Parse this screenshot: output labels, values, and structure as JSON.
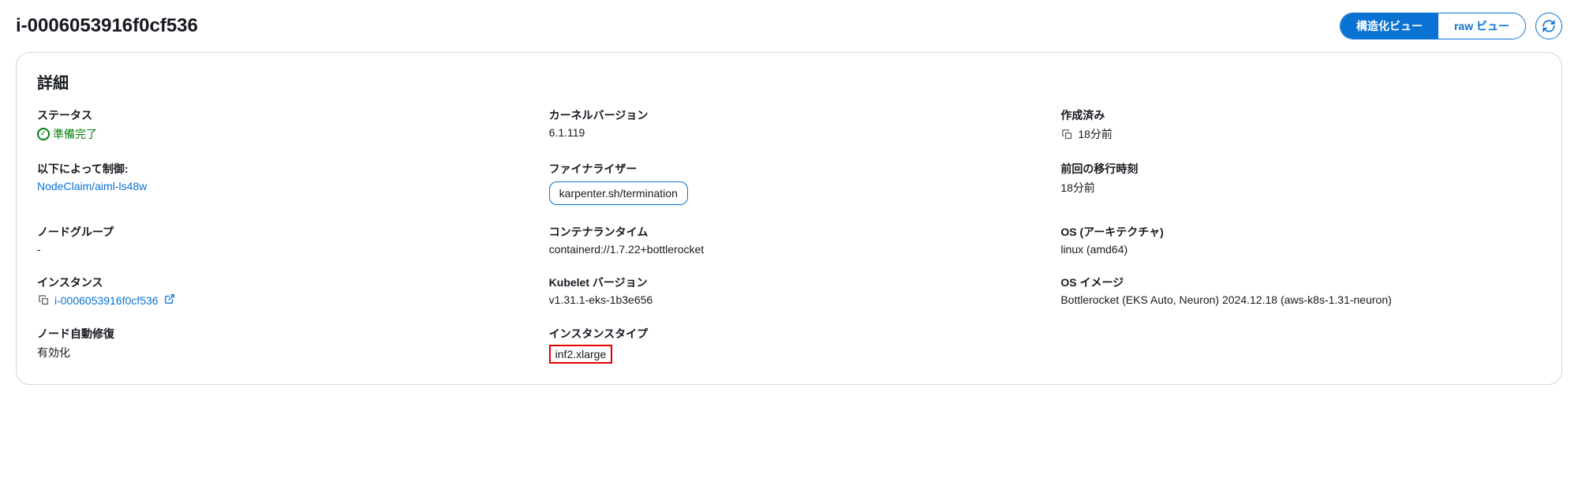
{
  "header": {
    "title": "i-0006053916f0cf536",
    "structured_view": "構造化ビュー",
    "raw_view": "raw ビュー"
  },
  "panel": {
    "title": "詳細",
    "fields": {
      "status_label": "ステータス",
      "status_value": "準備完了",
      "kernel_label": "カーネルバージョン",
      "kernel_value": "6.1.119",
      "created_label": "作成済み",
      "created_value": "18分前",
      "controlled_by_label": "以下によって制御:",
      "controlled_by_value": "NodeClaim/aiml-ls48w",
      "finalizer_label": "ファイナライザー",
      "finalizer_value": "karpenter.sh/termination",
      "last_transition_label": "前回の移行時刻",
      "last_transition_value": "18分前",
      "nodegroup_label": "ノードグループ",
      "nodegroup_value": "-",
      "runtime_label": "コンテナランタイム",
      "runtime_value": "containerd://1.7.22+bottlerocket",
      "os_arch_label": "OS (アーキテクチャ)",
      "os_arch_value": "linux (amd64)",
      "instance_label": "インスタンス",
      "instance_value": "i-0006053916f0cf536",
      "kubelet_label": "Kubelet バージョン",
      "kubelet_value": "v1.31.1-eks-1b3e656",
      "os_image_label": "OS イメージ",
      "os_image_value": "Bottlerocket (EKS Auto, Neuron) 2024.12.18 (aws-k8s-1.31-neuron)",
      "auto_repair_label": "ノード自動修復",
      "auto_repair_value": "有効化",
      "instance_type_label": "インスタンスタイプ",
      "instance_type_value": "inf2.xlarge"
    }
  }
}
